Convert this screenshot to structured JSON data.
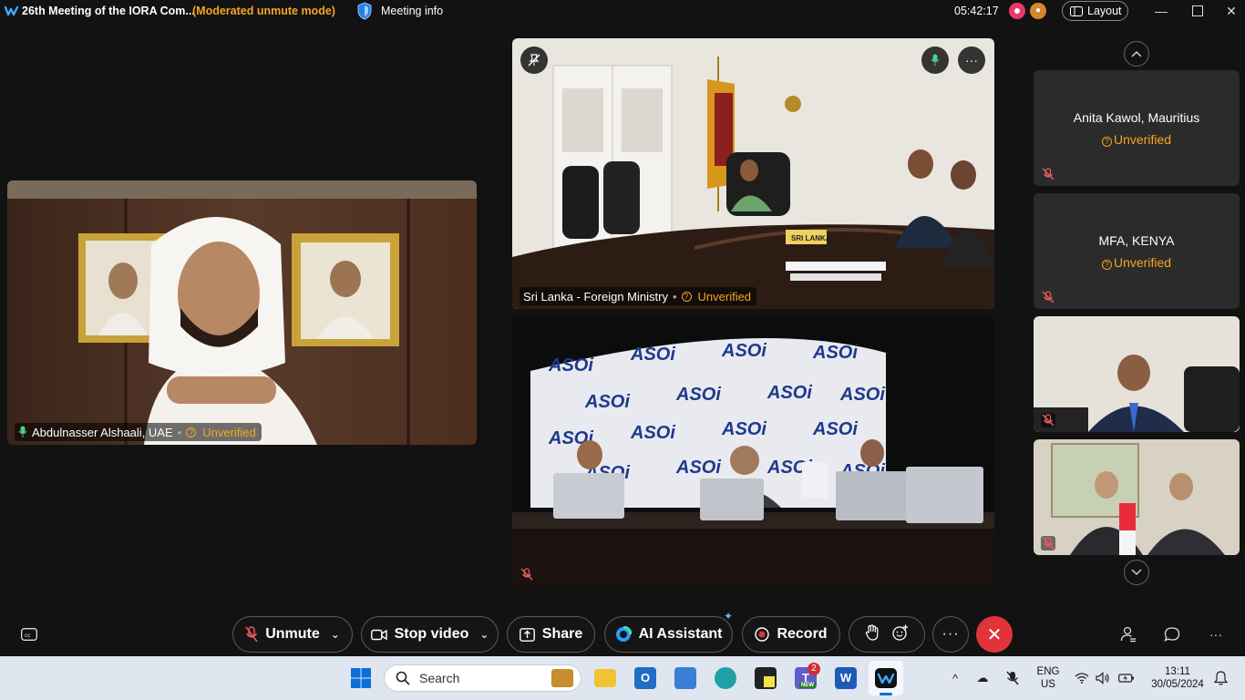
{
  "titlebar": {
    "title": "26th Meeting of the IORA Com...",
    "mode": "(Moderated unmute mode)",
    "meeting_info": "Meeting info",
    "clock": "05:42:17",
    "layout_label": "Layout"
  },
  "tiles": {
    "uae": {
      "name": "Abdulnasser Alshaali, UAE",
      "status": "Unverified"
    },
    "sri_lanka": {
      "name": "Sri Lanka - Foreign Ministry",
      "status": "Unverified"
    },
    "room_sign": "SRI LANKA",
    "backdrop_logo": "ASOi"
  },
  "side_panel": [
    {
      "name": "Anita Kawol, Mauritius",
      "status": "Unverified"
    },
    {
      "name": "MFA, KENYA",
      "status": "Unverified"
    }
  ],
  "controls": {
    "unmute": "Unmute",
    "stop_video": "Stop video",
    "share": "Share",
    "ai_assistant": "AI Assistant",
    "record": "Record"
  },
  "taskbar": {
    "search_placeholder": "Search",
    "teams_badge": "2",
    "teams_new": "NEW",
    "lang_top": "ENG",
    "lang_bottom": "US",
    "time": "13:11",
    "date": "30/05/2024"
  },
  "colors": {
    "accent_unverified": "#f5a623",
    "end_call": "#e0343a",
    "taskbar_bg": "#dfe6f0"
  }
}
